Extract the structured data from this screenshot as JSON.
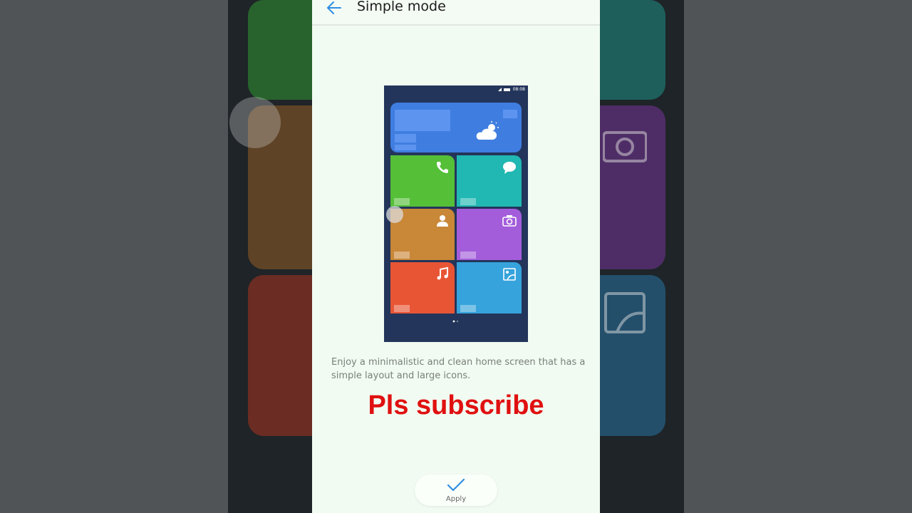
{
  "header": {
    "title": "Simple mode",
    "back_icon": "arrow-left-icon"
  },
  "preview": {
    "status_time": "08:08",
    "tiles": [
      {
        "name": "weather",
        "icon": "weather-cloud-icon",
        "color": "#3f7ee0"
      },
      {
        "name": "phone",
        "icon": "phone-icon",
        "color": "#55bf38"
      },
      {
        "name": "messages",
        "icon": "message-bubble-icon",
        "color": "#21b7b2"
      },
      {
        "name": "contacts",
        "icon": "person-icon",
        "color": "#c98738"
      },
      {
        "name": "camera",
        "icon": "camera-icon",
        "color": "#a35dda"
      },
      {
        "name": "music",
        "icon": "music-note-icon",
        "color": "#e85535"
      },
      {
        "name": "gallery",
        "icon": "gallery-icon",
        "color": "#36a3dc"
      }
    ]
  },
  "description": "Enjoy a minimalistic and clean home screen that has a simple layout and large icons.",
  "overlay_text": "Pls subscribe",
  "apply": {
    "label": "Apply",
    "icon": "check-icon"
  },
  "colors": {
    "accent": "#2f8de4",
    "overlay": "#e01010",
    "screen_bg": "#f1fbf1"
  }
}
